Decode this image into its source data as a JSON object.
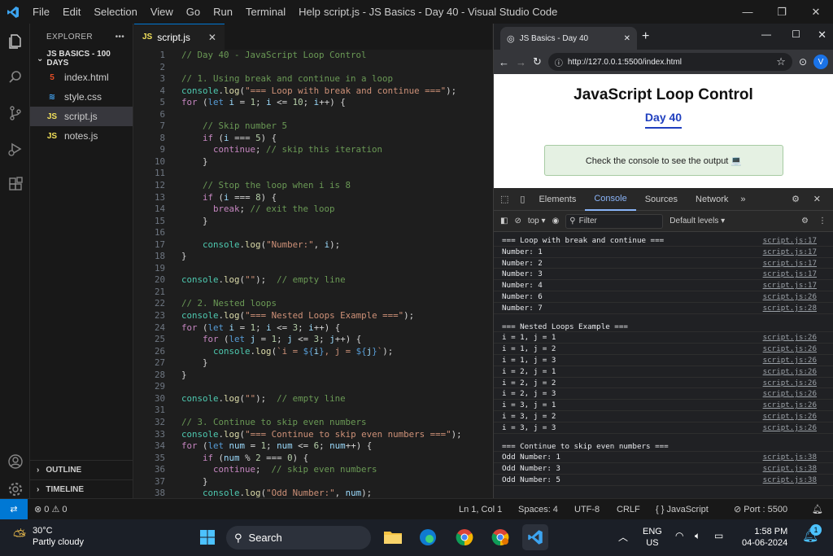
{
  "titlebar": {
    "menu": [
      "File",
      "Edit",
      "Selection",
      "View",
      "Go",
      "Run",
      "Terminal",
      "Help"
    ],
    "title": "script.js - JS Basics - Day 40 - Visual Studio Code"
  },
  "sidebar": {
    "header": "EXPLORER",
    "project": "JS BASICS - 100 DAYS",
    "files": [
      {
        "name": "index.html",
        "icon": "5",
        "color": "#e44d26"
      },
      {
        "name": "style.css",
        "icon": "≋",
        "color": "#42a5f5"
      },
      {
        "name": "script.js",
        "icon": "JS",
        "color": "#f1e05a"
      },
      {
        "name": "notes.js",
        "icon": "JS",
        "color": "#f1e05a"
      }
    ],
    "outline": "OUTLINE",
    "timeline": "TIMELINE"
  },
  "editor": {
    "tab": "script.js",
    "lines": [
      [
        [
          "c",
          "// Day 40 - JavaScript Loop Control"
        ]
      ],
      [],
      [
        [
          "c",
          "// 1. Using break and continue in a loop"
        ]
      ],
      [
        [
          "cl",
          "console"
        ],
        [
          "o",
          "."
        ],
        [
          "f",
          "log"
        ],
        [
          "o",
          "("
        ],
        [
          "s",
          "\"=== Loop with break and continue ===\""
        ],
        [
          "o",
          ");"
        ]
      ],
      [
        [
          "kf",
          "for"
        ],
        [
          "o",
          " ("
        ],
        [
          "k",
          "let"
        ],
        [
          "v",
          " i"
        ],
        [
          "o",
          " = "
        ],
        [
          "n",
          "1"
        ],
        [
          "o",
          "; "
        ],
        [
          "v",
          "i"
        ],
        [
          "o",
          " <= "
        ],
        [
          "n",
          "10"
        ],
        [
          "o",
          "; "
        ],
        [
          "v",
          "i"
        ],
        [
          "o",
          "++) {"
        ]
      ],
      [],
      [
        [
          "o",
          "    "
        ],
        [
          "c",
          "// Skip number 5"
        ]
      ],
      [
        [
          "o",
          "    "
        ],
        [
          "kf",
          "if"
        ],
        [
          "o",
          " ("
        ],
        [
          "v",
          "i"
        ],
        [
          "o",
          " === "
        ],
        [
          "n",
          "5"
        ],
        [
          "o",
          ") {"
        ]
      ],
      [
        [
          "o",
          "      "
        ],
        [
          "kf",
          "continue"
        ],
        [
          "o",
          "; "
        ],
        [
          "c",
          "// skip this iteration"
        ]
      ],
      [
        [
          "o",
          "    }"
        ]
      ],
      [],
      [
        [
          "o",
          "    "
        ],
        [
          "c",
          "// Stop the loop when i is 8"
        ]
      ],
      [
        [
          "o",
          "    "
        ],
        [
          "kf",
          "if"
        ],
        [
          "o",
          " ("
        ],
        [
          "v",
          "i"
        ],
        [
          "o",
          " === "
        ],
        [
          "n",
          "8"
        ],
        [
          "o",
          ") {"
        ]
      ],
      [
        [
          "o",
          "      "
        ],
        [
          "kf",
          "break"
        ],
        [
          "o",
          "; "
        ],
        [
          "c",
          "// exit the loop"
        ]
      ],
      [
        [
          "o",
          "    }"
        ]
      ],
      [],
      [
        [
          "o",
          "    "
        ],
        [
          "cl",
          "console"
        ],
        [
          "o",
          "."
        ],
        [
          "f",
          "log"
        ],
        [
          "o",
          "("
        ],
        [
          "s",
          "\"Number:\""
        ],
        [
          "o",
          ", "
        ],
        [
          "v",
          "i"
        ],
        [
          "o",
          ");"
        ]
      ],
      [
        [
          "o",
          "}"
        ]
      ],
      [],
      [
        [
          "cl",
          "console"
        ],
        [
          "o",
          "."
        ],
        [
          "f",
          "log"
        ],
        [
          "o",
          "("
        ],
        [
          "s",
          "\"\""
        ],
        [
          "o",
          ");  "
        ],
        [
          "c",
          "// empty line"
        ]
      ],
      [],
      [
        [
          "c",
          "// 2. Nested loops"
        ]
      ],
      [
        [
          "cl",
          "console"
        ],
        [
          "o",
          "."
        ],
        [
          "f",
          "log"
        ],
        [
          "o",
          "("
        ],
        [
          "s",
          "\"=== Nested Loops Example ===\""
        ],
        [
          "o",
          ");"
        ]
      ],
      [
        [
          "kf",
          "for"
        ],
        [
          "o",
          " ("
        ],
        [
          "k",
          "let"
        ],
        [
          "v",
          " i"
        ],
        [
          "o",
          " = "
        ],
        [
          "n",
          "1"
        ],
        [
          "o",
          "; "
        ],
        [
          "v",
          "i"
        ],
        [
          "o",
          " <= "
        ],
        [
          "n",
          "3"
        ],
        [
          "o",
          "; "
        ],
        [
          "v",
          "i"
        ],
        [
          "o",
          "++) {"
        ]
      ],
      [
        [
          "o",
          "    "
        ],
        [
          "kf",
          "for"
        ],
        [
          "o",
          " ("
        ],
        [
          "k",
          "let"
        ],
        [
          "v",
          " j"
        ],
        [
          "o",
          " = "
        ],
        [
          "n",
          "1"
        ],
        [
          "o",
          "; "
        ],
        [
          "v",
          "j"
        ],
        [
          "o",
          " <= "
        ],
        [
          "n",
          "3"
        ],
        [
          "o",
          "; "
        ],
        [
          "v",
          "j"
        ],
        [
          "o",
          "++) {"
        ]
      ],
      [
        [
          "o",
          "      "
        ],
        [
          "cl",
          "console"
        ],
        [
          "o",
          "."
        ],
        [
          "f",
          "log"
        ],
        [
          "o",
          "("
        ],
        [
          "s",
          "`i = "
        ],
        [
          "k",
          "${"
        ],
        [
          "v",
          "i"
        ],
        [
          "k",
          "}"
        ],
        [
          "s",
          ", j = "
        ],
        [
          "k",
          "${"
        ],
        [
          "v",
          "j"
        ],
        [
          "k",
          "}"
        ],
        [
          "s",
          "`"
        ],
        [
          "o",
          ");"
        ]
      ],
      [
        [
          "o",
          "    }"
        ]
      ],
      [
        [
          "o",
          "}"
        ]
      ],
      [],
      [
        [
          "cl",
          "console"
        ],
        [
          "o",
          "."
        ],
        [
          "f",
          "log"
        ],
        [
          "o",
          "("
        ],
        [
          "s",
          "\"\""
        ],
        [
          "o",
          ");  "
        ],
        [
          "c",
          "// empty line"
        ]
      ],
      [],
      [
        [
          "c",
          "// 3. Continue to skip even numbers"
        ]
      ],
      [
        [
          "cl",
          "console"
        ],
        [
          "o",
          "."
        ],
        [
          "f",
          "log"
        ],
        [
          "o",
          "("
        ],
        [
          "s",
          "\"=== Continue to skip even numbers ===\""
        ],
        [
          "o",
          ");"
        ]
      ],
      [
        [
          "kf",
          "for"
        ],
        [
          "o",
          " ("
        ],
        [
          "k",
          "let"
        ],
        [
          "v",
          " num"
        ],
        [
          "o",
          " = "
        ],
        [
          "n",
          "1"
        ],
        [
          "o",
          "; "
        ],
        [
          "v",
          "num"
        ],
        [
          "o",
          " <= "
        ],
        [
          "n",
          "6"
        ],
        [
          "o",
          "; "
        ],
        [
          "v",
          "num"
        ],
        [
          "o",
          "++) {"
        ]
      ],
      [
        [
          "o",
          "    "
        ],
        [
          "kf",
          "if"
        ],
        [
          "o",
          " ("
        ],
        [
          "v",
          "num"
        ],
        [
          "o",
          " % "
        ],
        [
          "n",
          "2"
        ],
        [
          "o",
          " === "
        ],
        [
          "n",
          "0"
        ],
        [
          "o",
          ") {"
        ]
      ],
      [
        [
          "o",
          "      "
        ],
        [
          "kf",
          "continue"
        ],
        [
          "o",
          ";  "
        ],
        [
          "c",
          "// skip even numbers"
        ]
      ],
      [
        [
          "o",
          "    }"
        ]
      ],
      [
        [
          "o",
          "    "
        ],
        [
          "cl",
          "console"
        ],
        [
          "o",
          "."
        ],
        [
          "f",
          "log"
        ],
        [
          "o",
          "("
        ],
        [
          "s",
          "\"Odd Number:\""
        ],
        [
          "o",
          ", "
        ],
        [
          "v",
          "num"
        ],
        [
          "o",
          ");"
        ]
      ]
    ]
  },
  "browser": {
    "tab_title": "JS Basics - Day 40",
    "url": "http://127.0.0.1:5500/index.html",
    "profile": "V",
    "page_title": "JavaScript Loop Control",
    "page_subtitle": "Day 40",
    "page_box": "Check the console to see the output 💻",
    "devtools": {
      "tabs": [
        "Elements",
        "Console",
        "Sources",
        "Network"
      ],
      "context": "top",
      "filter": "Filter",
      "levels": "Default levels",
      "logs": [
        {
          "t": "=== Loop with break and continue ===",
          "s": "script.js:17"
        },
        {
          "t": "Number: 1",
          "s": "script.js:17"
        },
        {
          "t": "Number: 2",
          "s": "script.js:17"
        },
        {
          "t": "Number: 3",
          "s": "script.js:17"
        },
        {
          "t": "Number: 4",
          "s": "script.js:17"
        },
        {
          "t": "Number: 6",
          "s": "script.js:26"
        },
        {
          "t": "Number: 7",
          "s": "script.js:28"
        },
        {
          "gap": true
        },
        {
          "t": "=== Nested Loops Example ===",
          "s": ""
        },
        {
          "t": "i = 1, j = 1",
          "s": "script.js:26"
        },
        {
          "t": "i = 1, j = 2",
          "s": "script.js:26"
        },
        {
          "t": "i = 1, j = 3",
          "s": "script.js:26"
        },
        {
          "t": "i = 2, j = 1",
          "s": "script.js:26"
        },
        {
          "t": "i = 2, j = 2",
          "s": "script.js:26"
        },
        {
          "t": "i = 2, j = 3",
          "s": "script.js:26"
        },
        {
          "t": "i = 3, j = 1",
          "s": "script.js:26"
        },
        {
          "t": "i = 3, j = 2",
          "s": "script.js:26"
        },
        {
          "t": "i = 3, j = 3",
          "s": "script.js:26"
        },
        {
          "gap": true
        },
        {
          "t": "=== Continue to skip even numbers ===",
          "s": ""
        },
        {
          "t": "Odd Number: 1",
          "s": "script.js:38"
        },
        {
          "t": "Odd Number: 3",
          "s": "script.js:38"
        },
        {
          "t": "Odd Number: 5",
          "s": "script.js:38"
        }
      ]
    }
  },
  "status": {
    "errors": "0",
    "warnings": "0",
    "position": "Ln 1, Col 1",
    "spaces": "Spaces: 4",
    "encoding": "UTF-8",
    "eol": "CRLF",
    "language": "JavaScript",
    "port": "Port : 5500"
  },
  "taskbar": {
    "temp": "30°C",
    "weather": "Partly cloudy",
    "search": "Search",
    "lang1": "ENG",
    "lang2": "US",
    "time": "1:58 PM",
    "date": "04-06-2024",
    "notif": "1"
  },
  "colors": {
    "accent": "#0078d4",
    "vscode_blue": "#0078d4"
  }
}
